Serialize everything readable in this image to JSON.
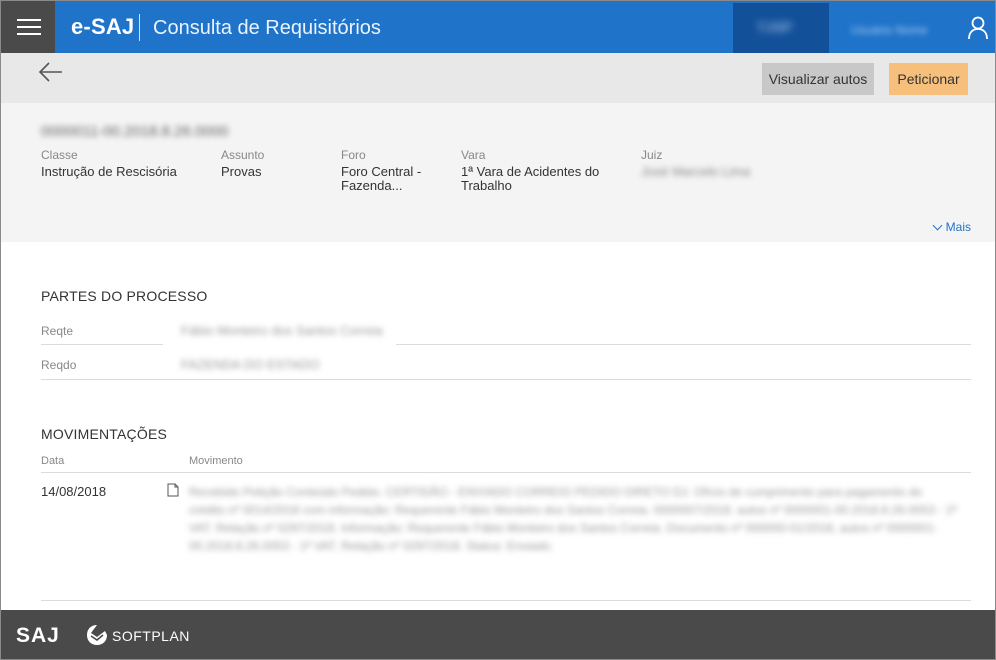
{
  "header": {
    "brand": "e-SAJ",
    "app_title": "Consulta de Requisitórios",
    "court": "TJSP",
    "user_name": "Usuário Nome"
  },
  "actions": {
    "view_label": "Visualizar autos",
    "petition_label": "Peticionar"
  },
  "process": {
    "number": "0000011-00.2018.8.26.0000",
    "fields": [
      {
        "label": "Classe",
        "value": "Instrução de Rescisória"
      },
      {
        "label": "Assunto",
        "value": "Provas"
      },
      {
        "label": "Foro",
        "value": "Foro Central - Fazenda..."
      },
      {
        "label": "Vara",
        "value": "1ª Vara de Acidentes do Trabalho"
      },
      {
        "label": "Juiz",
        "value": "José Marcelo Lima"
      }
    ],
    "more_label": "Mais"
  },
  "parties": {
    "title": "PARTES DO PROCESSO",
    "rows": [
      {
        "label": "Reqte",
        "name": "Fábio Monteiro dos Santos Correia"
      },
      {
        "label": "Reqdo",
        "name": "FAZENDA DO ESTADO"
      }
    ]
  },
  "movements": {
    "title": "MOVIMENTAÇÕES",
    "col_date": "Data",
    "col_movement": "Movimento",
    "rows": [
      {
        "date": "14/08/2018",
        "text": "Recebido Petição Conteúdo Pedido. CERTIDÃO - ENVIADO CORREIO PEDIDO DIRETO DJ. Ofício de cumprimento para pagamento do crédito nº 0014/2018 com informação: Requerente Fábio Monteiro dos Santos Correia. 0000007/2018. autos nº 0000001-00.2018.8.26.0053 - 1ª VAT. Relação nº 0297/2018. Informação: Requerente Fábio Monteiro dos Santos Correia. Documento nº 000000-01/2018, autos nº 0000001-00.2018.8.26.0053 - 1ª VAT. Relação nº 0297/2018. Status: Enviado."
      }
    ]
  },
  "footer": {
    "saj": "SAJ",
    "softplan": "SOFTPLAN"
  },
  "colors": {
    "header_blue": "#1f73c9",
    "petition_orange": "#f6c07c",
    "footer_gray": "#4a4a4a"
  }
}
